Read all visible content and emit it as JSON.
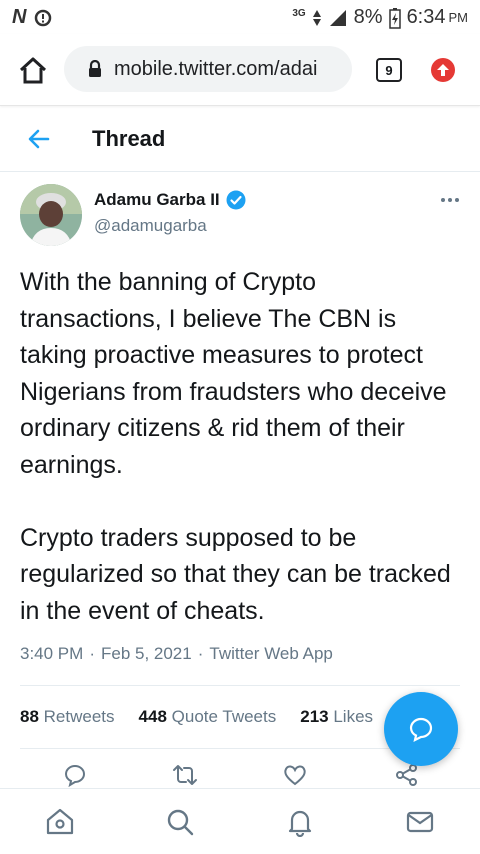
{
  "status_bar": {
    "carrier_icon": "n-icon",
    "network_type": "3G",
    "battery_percent": "8%",
    "time": "6:34",
    "ampm": "PM"
  },
  "browser": {
    "url": "mobile.twitter.com/adai",
    "tab_count": "9",
    "icons": [
      "home-icon",
      "lock-icon",
      "tabs-icon",
      "update-icon"
    ]
  },
  "header": {
    "title": "Thread"
  },
  "tweet": {
    "author_name": "Adamu Garba II",
    "author_handle": "@adamugarba",
    "text": "With the banning of Crypto transactions, I believe The CBN is taking proactive measures to protect Nigerians from fraudsters who deceive ordinary citizens & rid them of their earnings.\n\nCrypto traders supposed to be regularized so that they can be tracked in the event of cheats.",
    "time": "3:40 PM",
    "date": "Feb 5, 2021",
    "source": "Twitter Web App",
    "sep": "·"
  },
  "stats": {
    "retweets_count": "88",
    "retweets_label": "Retweets",
    "quotes_count": "448",
    "quotes_label": "Quote Tweets",
    "likes_count": "213",
    "likes_label": "Likes"
  },
  "colors": {
    "accent": "#1da1f2",
    "text": "#14171a",
    "secondary": "#657786",
    "update_badge": "#e53935"
  }
}
